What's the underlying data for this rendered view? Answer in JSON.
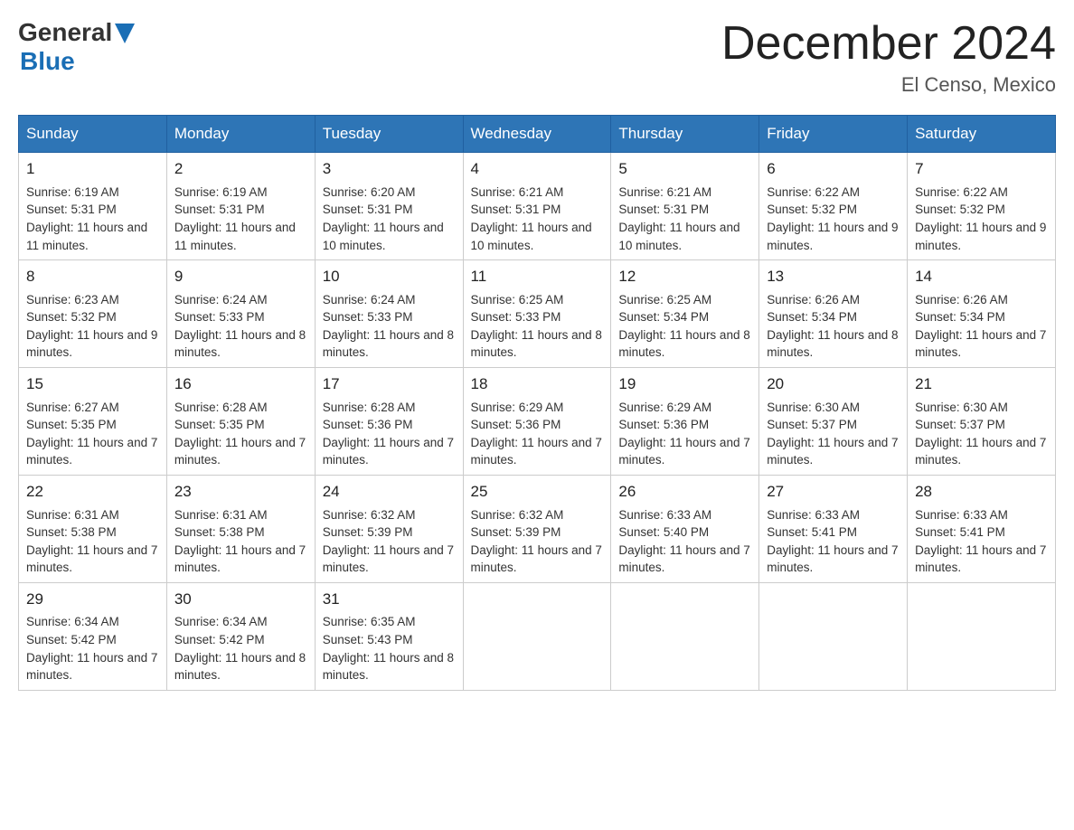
{
  "header": {
    "logo_general": "General",
    "logo_blue": "Blue",
    "month_title": "December 2024",
    "location": "El Censo, Mexico"
  },
  "columns": [
    "Sunday",
    "Monday",
    "Tuesday",
    "Wednesday",
    "Thursday",
    "Friday",
    "Saturday"
  ],
  "weeks": [
    [
      {
        "day": "1",
        "sunrise": "6:19 AM",
        "sunset": "5:31 PM",
        "daylight": "11 hours and 11 minutes."
      },
      {
        "day": "2",
        "sunrise": "6:19 AM",
        "sunset": "5:31 PM",
        "daylight": "11 hours and 11 minutes."
      },
      {
        "day": "3",
        "sunrise": "6:20 AM",
        "sunset": "5:31 PM",
        "daylight": "11 hours and 10 minutes."
      },
      {
        "day": "4",
        "sunrise": "6:21 AM",
        "sunset": "5:31 PM",
        "daylight": "11 hours and 10 minutes."
      },
      {
        "day": "5",
        "sunrise": "6:21 AM",
        "sunset": "5:31 PM",
        "daylight": "11 hours and 10 minutes."
      },
      {
        "day": "6",
        "sunrise": "6:22 AM",
        "sunset": "5:32 PM",
        "daylight": "11 hours and 9 minutes."
      },
      {
        "day": "7",
        "sunrise": "6:22 AM",
        "sunset": "5:32 PM",
        "daylight": "11 hours and 9 minutes."
      }
    ],
    [
      {
        "day": "8",
        "sunrise": "6:23 AM",
        "sunset": "5:32 PM",
        "daylight": "11 hours and 9 minutes."
      },
      {
        "day": "9",
        "sunrise": "6:24 AM",
        "sunset": "5:33 PM",
        "daylight": "11 hours and 8 minutes."
      },
      {
        "day": "10",
        "sunrise": "6:24 AM",
        "sunset": "5:33 PM",
        "daylight": "11 hours and 8 minutes."
      },
      {
        "day": "11",
        "sunrise": "6:25 AM",
        "sunset": "5:33 PM",
        "daylight": "11 hours and 8 minutes."
      },
      {
        "day": "12",
        "sunrise": "6:25 AM",
        "sunset": "5:34 PM",
        "daylight": "11 hours and 8 minutes."
      },
      {
        "day": "13",
        "sunrise": "6:26 AM",
        "sunset": "5:34 PM",
        "daylight": "11 hours and 8 minutes."
      },
      {
        "day": "14",
        "sunrise": "6:26 AM",
        "sunset": "5:34 PM",
        "daylight": "11 hours and 7 minutes."
      }
    ],
    [
      {
        "day": "15",
        "sunrise": "6:27 AM",
        "sunset": "5:35 PM",
        "daylight": "11 hours and 7 minutes."
      },
      {
        "day": "16",
        "sunrise": "6:28 AM",
        "sunset": "5:35 PM",
        "daylight": "11 hours and 7 minutes."
      },
      {
        "day": "17",
        "sunrise": "6:28 AM",
        "sunset": "5:36 PM",
        "daylight": "11 hours and 7 minutes."
      },
      {
        "day": "18",
        "sunrise": "6:29 AM",
        "sunset": "5:36 PM",
        "daylight": "11 hours and 7 minutes."
      },
      {
        "day": "19",
        "sunrise": "6:29 AM",
        "sunset": "5:36 PM",
        "daylight": "11 hours and 7 minutes."
      },
      {
        "day": "20",
        "sunrise": "6:30 AM",
        "sunset": "5:37 PM",
        "daylight": "11 hours and 7 minutes."
      },
      {
        "day": "21",
        "sunrise": "6:30 AM",
        "sunset": "5:37 PM",
        "daylight": "11 hours and 7 minutes."
      }
    ],
    [
      {
        "day": "22",
        "sunrise": "6:31 AM",
        "sunset": "5:38 PM",
        "daylight": "11 hours and 7 minutes."
      },
      {
        "day": "23",
        "sunrise": "6:31 AM",
        "sunset": "5:38 PM",
        "daylight": "11 hours and 7 minutes."
      },
      {
        "day": "24",
        "sunrise": "6:32 AM",
        "sunset": "5:39 PM",
        "daylight": "11 hours and 7 minutes."
      },
      {
        "day": "25",
        "sunrise": "6:32 AM",
        "sunset": "5:39 PM",
        "daylight": "11 hours and 7 minutes."
      },
      {
        "day": "26",
        "sunrise": "6:33 AM",
        "sunset": "5:40 PM",
        "daylight": "11 hours and 7 minutes."
      },
      {
        "day": "27",
        "sunrise": "6:33 AM",
        "sunset": "5:41 PM",
        "daylight": "11 hours and 7 minutes."
      },
      {
        "day": "28",
        "sunrise": "6:33 AM",
        "sunset": "5:41 PM",
        "daylight": "11 hours and 7 minutes."
      }
    ],
    [
      {
        "day": "29",
        "sunrise": "6:34 AM",
        "sunset": "5:42 PM",
        "daylight": "11 hours and 7 minutes."
      },
      {
        "day": "30",
        "sunrise": "6:34 AM",
        "sunset": "5:42 PM",
        "daylight": "11 hours and 8 minutes."
      },
      {
        "day": "31",
        "sunrise": "6:35 AM",
        "sunset": "5:43 PM",
        "daylight": "11 hours and 8 minutes."
      },
      null,
      null,
      null,
      null
    ]
  ],
  "labels": {
    "sunrise": "Sunrise:",
    "sunset": "Sunset:",
    "daylight": "Daylight:"
  }
}
